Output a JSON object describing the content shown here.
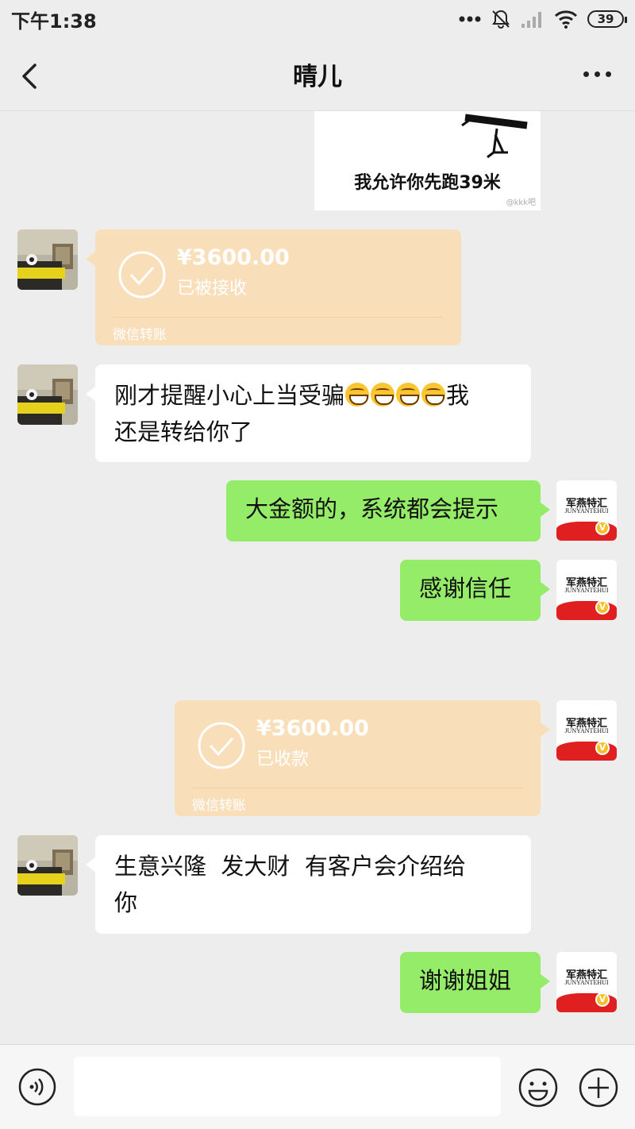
{
  "status_bar": {
    "time": "下午1:38",
    "battery": "39",
    "signal_icon": "signal-icon",
    "wifi_icon": "wifi-icon",
    "mute_icon": "mute-icon"
  },
  "header": {
    "title": "晴儿",
    "back_icon": "chevron-left-icon",
    "more_icon": "more-dots-icon"
  },
  "sticker": {
    "caption": "我允许你先跑39米",
    "watermark": "@kkk吧"
  },
  "avatars": {
    "contact": "contact-avatar",
    "self_brand_top": "军燕特汇",
    "self_brand_bottom": "JUNYANTEHUI",
    "self_badge": "V"
  },
  "messages": [
    {
      "type": "transfer",
      "side": "left",
      "amount": "¥3600.00",
      "status": "已被接收",
      "footer": "微信转账"
    },
    {
      "type": "text",
      "side": "left",
      "text_1": "刚才提醒小心上当受骗",
      "text_2": "我",
      "text_3": "还是转给你了"
    },
    {
      "type": "text",
      "side": "right",
      "text": "大金额的，系统都会提示"
    },
    {
      "type": "text",
      "side": "right",
      "text": "感谢信任"
    },
    {
      "type": "transfer",
      "side": "right",
      "amount": "¥3600.00",
      "status": "已收款",
      "footer": "微信转账"
    },
    {
      "type": "text",
      "side": "left",
      "text_1": "生意兴隆  发大财  有客户会介绍给",
      "text_2": "你"
    },
    {
      "type": "text",
      "side": "right",
      "text": "谢谢姐姐"
    }
  ],
  "input_bar": {
    "voice_icon": "voice-icon",
    "input_value": "",
    "emoji_icon": "emoji-icon",
    "plus_icon": "plus-icon"
  },
  "colors": {
    "background": "#ededed",
    "self_bubble": "#95ec69",
    "other_bubble": "#ffffff",
    "transfer_bubble": "#f9deba"
  }
}
